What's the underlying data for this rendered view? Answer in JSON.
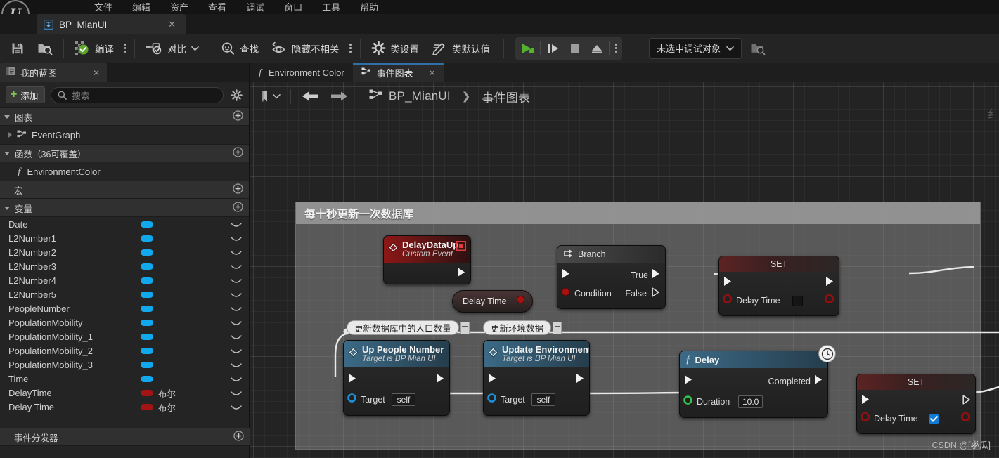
{
  "menubar": {
    "items": [
      "文件",
      "编辑",
      "资产",
      "查看",
      "调试",
      "窗口",
      "工具",
      "帮助"
    ]
  },
  "file_tab": {
    "label": "BP_MianUI",
    "close": "✕",
    "icon": "blueprint-icon"
  },
  "toolbar": {
    "save_label": "",
    "browse_label": "",
    "compile_label": "编译",
    "diff_label": "对比",
    "find_label": "查找",
    "hide_unrelated_label": "隐藏不相关",
    "class_settings_label": "类设置",
    "class_defaults_label": "类默认值",
    "debug_object": "未选中调试对象"
  },
  "left_panel": {
    "tab_label": "我的蓝图",
    "tab_close": "✕",
    "add_label": "添加",
    "search_placeholder": "搜索",
    "sections": [
      {
        "name": "图表",
        "expanded": true
      },
      {
        "name": "函数（36可覆盖）",
        "expanded": true
      },
      {
        "name": "宏",
        "expanded": false
      },
      {
        "name": "变量",
        "expanded": true
      },
      {
        "name": "事件分发器",
        "expanded": false
      }
    ],
    "graphs": [
      {
        "label": "EventGraph",
        "icon": "graph-icon"
      }
    ],
    "functions": [
      {
        "label": "EnvironmentColor",
        "icon": "function-icon"
      }
    ],
    "variables": [
      {
        "name": "Date",
        "type": "",
        "color": "#12a8ee"
      },
      {
        "name": "L2Number1",
        "type": "",
        "color": "#12a8ee"
      },
      {
        "name": "L2Number2",
        "type": "",
        "color": "#12a8ee"
      },
      {
        "name": "L2Number3",
        "type": "",
        "color": "#12a8ee"
      },
      {
        "name": "L2Number4",
        "type": "",
        "color": "#12a8ee"
      },
      {
        "name": "L2Number5",
        "type": "",
        "color": "#12a8ee"
      },
      {
        "name": "PeopleNumber",
        "type": "",
        "color": "#12a8ee"
      },
      {
        "name": "PopulationMobility",
        "type": "",
        "color": "#12a8ee"
      },
      {
        "name": "PopulationMobility_1",
        "type": "",
        "color": "#12a8ee"
      },
      {
        "name": "PopulationMobility_2",
        "type": "",
        "color": "#12a8ee"
      },
      {
        "name": "PopulationMobility_3",
        "type": "",
        "color": "#12a8ee"
      },
      {
        "name": "Time",
        "type": "",
        "color": "#12a8ee"
      },
      {
        "name": "DelayTime",
        "type": "布尔",
        "color": "#a31515"
      },
      {
        "name": "Delay Time",
        "type": "布尔",
        "color": "#a31515"
      }
    ]
  },
  "graph": {
    "tabs": [
      {
        "label": "Environment Color",
        "icon": "function-icon",
        "active": false,
        "closable": false
      },
      {
        "label": "事件图表",
        "icon": "graph-icon",
        "active": true,
        "closable": true,
        "close": "✕"
      }
    ],
    "breadcrumb": {
      "root": "BP_MianUI",
      "separator": "❯",
      "current": "事件图表"
    },
    "comment": {
      "title": "每十秒更新一次数据库"
    },
    "nodes": [
      {
        "id": "delay-data-up",
        "title": "DelayDataUp",
        "subtitle": "Custom Event",
        "kind": "custom-event"
      },
      {
        "id": "branch",
        "title": "Branch",
        "kind": "branch",
        "pins": {
          "condition": "Condition",
          "true": "True",
          "false": "False"
        }
      },
      {
        "id": "getter-delay-time",
        "title": "Delay Time",
        "kind": "variable-get"
      },
      {
        "id": "set-delay-time-false",
        "title": "SET",
        "kind": "variable-set",
        "pin_label": "Delay Time",
        "checked": false
      },
      {
        "id": "up-people-number",
        "title": "Up People Number",
        "subtitle": "Target is BP Mian UI",
        "kind": "function-call",
        "pins": {
          "target": "Target",
          "target_value": "self"
        }
      },
      {
        "id": "update-environment",
        "title": "Update Environment",
        "subtitle": "Target is BP Mian UI",
        "kind": "function-call",
        "pins": {
          "target": "Target",
          "target_value": "self"
        }
      },
      {
        "id": "delay",
        "title": "Delay",
        "kind": "latent-function",
        "pins": {
          "completed": "Completed",
          "duration": "Duration",
          "duration_value": "10.0"
        }
      },
      {
        "id": "set-delay-time-true",
        "title": "SET",
        "kind": "variable-set",
        "pin_label": "Delay Time",
        "checked": true
      }
    ],
    "bubbles": [
      {
        "id": "bubble-people",
        "text": "更新数据库中的人口数量"
      },
      {
        "id": "bubble-env",
        "text": "更新环境数据"
      }
    ]
  },
  "watermark": "CSDN @[小瓜]",
  "edge_char": "纟",
  "colors": {
    "exec_wire": "#e8e8e8",
    "bool_wire": "#a61111",
    "accent_blue": "#12a8ee",
    "compile_green": "#5ea72c"
  }
}
